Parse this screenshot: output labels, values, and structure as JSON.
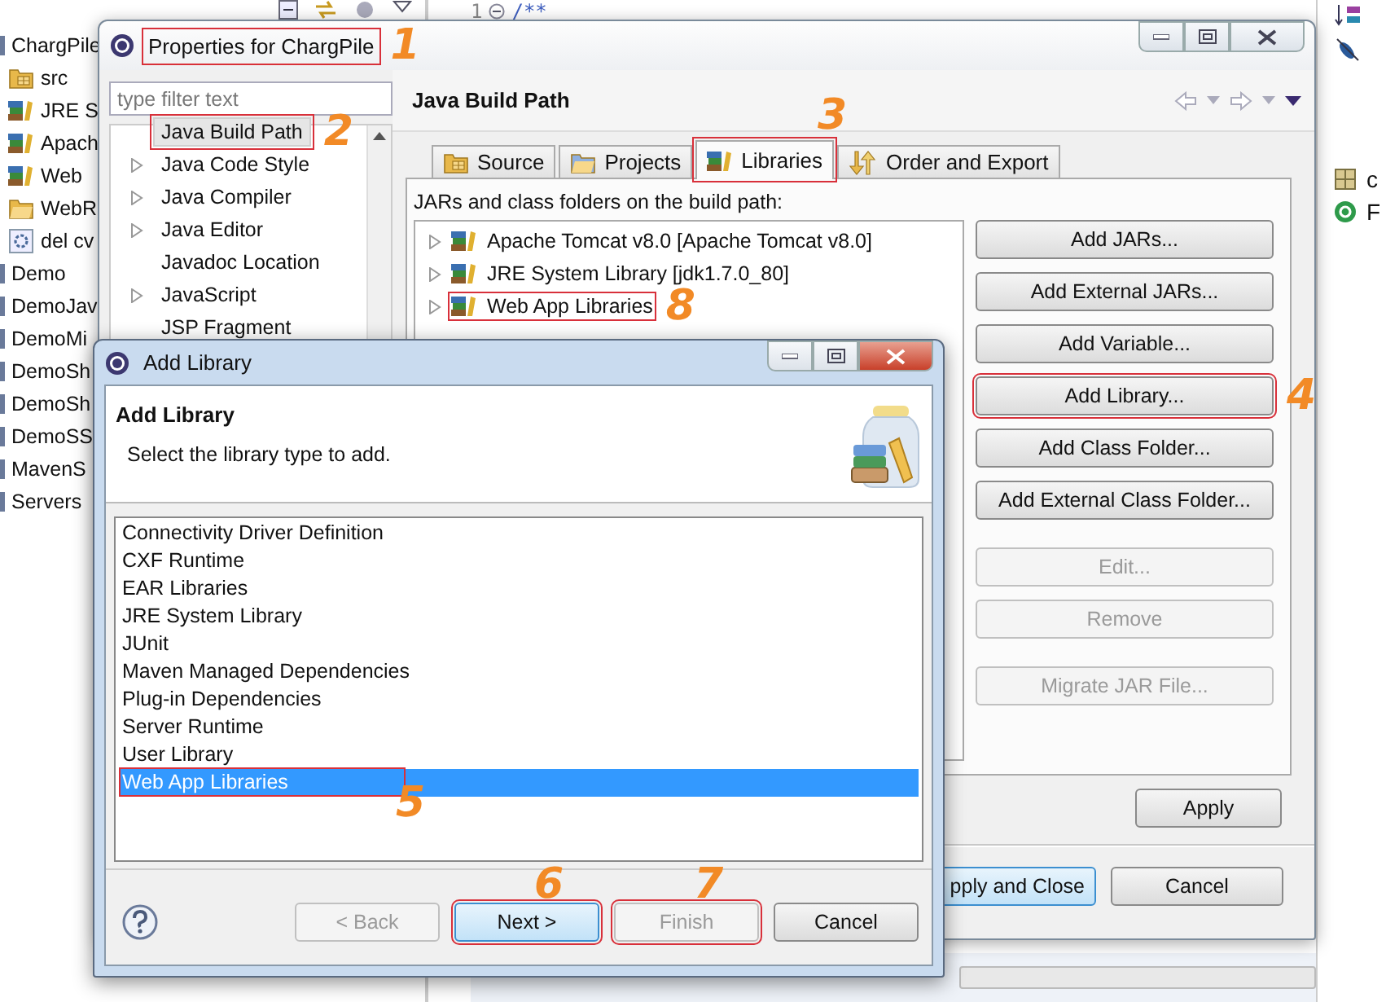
{
  "background_ide": {
    "explorer": {
      "items": [
        {
          "label": "ChargPile",
          "kind": "project",
          "children": [
            {
              "label": "src",
              "kind": "package-folder"
            },
            {
              "label": "JRE S",
              "kind": "library"
            },
            {
              "label": "Apach",
              "kind": "library"
            },
            {
              "label": "Web",
              "kind": "library"
            },
            {
              "label": "WebR",
              "kind": "folder"
            },
            {
              "label": "del cv",
              "kind": "file"
            }
          ]
        },
        {
          "label": "Demo",
          "kind": "project"
        },
        {
          "label": "DemoJav",
          "kind": "project"
        },
        {
          "label": "DemoMi",
          "kind": "project"
        },
        {
          "label": "DemoSh",
          "kind": "project"
        },
        {
          "label": "DemoSh",
          "kind": "project"
        },
        {
          "label": "DemoSS",
          "kind": "project"
        },
        {
          "label": "MavenS",
          "kind": "project"
        },
        {
          "label": "Servers",
          "kind": "project"
        }
      ]
    },
    "editor": {
      "line_number": "1",
      "code": "/**"
    },
    "outline": {
      "items": [
        {
          "label": "c",
          "kind": "grid"
        },
        {
          "label": "F",
          "kind": "class"
        }
      ]
    }
  },
  "properties_dialog": {
    "title": "Properties for ChargPile",
    "title_annotation": "1",
    "filter": {
      "placeholder": "type filter text"
    },
    "tree": [
      {
        "label": "Java Build Path",
        "expandable": false,
        "selected": true,
        "annotation": "2"
      },
      {
        "label": "Java Code Style",
        "expandable": true,
        "selected": false
      },
      {
        "label": "Java Compiler",
        "expandable": true,
        "selected": false
      },
      {
        "label": "Java Editor",
        "expandable": true,
        "selected": false
      },
      {
        "label": "Javadoc Location",
        "expandable": false,
        "selected": false
      },
      {
        "label": "JavaScript",
        "expandable": true,
        "selected": false
      },
      {
        "label": "JSP Fragment",
        "expandable": false,
        "selected": false
      }
    ],
    "page_title": "Java Build Path",
    "tabs": [
      {
        "label": "Source",
        "kind": "source",
        "selected": false
      },
      {
        "label": "Projects",
        "kind": "projects",
        "selected": false
      },
      {
        "label": "Libraries",
        "kind": "libraries",
        "selected": true,
        "annotation": "3"
      },
      {
        "label": "Order and Export",
        "kind": "order",
        "selected": false
      }
    ],
    "list_label": "JARs and class folders on the build path:",
    "libraries": [
      {
        "label": "Apache Tomcat v8.0 [Apache Tomcat v8.0]"
      },
      {
        "label": "JRE System Library [jdk1.7.0_80]"
      },
      {
        "label": "Web App Libraries",
        "annotation": "8"
      }
    ],
    "button_groups": [
      [
        {
          "label": "Add JARs...",
          "disabled": false
        },
        {
          "label": "Add External JARs...",
          "disabled": false
        },
        {
          "label": "Add Variable...",
          "disabled": false
        },
        {
          "label": "Add Library...",
          "disabled": false,
          "annotation": "4"
        },
        {
          "label": "Add Class Folder...",
          "disabled": false
        },
        {
          "label": "Add External Class Folder...",
          "disabled": false
        }
      ],
      [
        {
          "label": "Edit...",
          "disabled": true
        },
        {
          "label": "Remove",
          "disabled": true
        }
      ],
      [
        {
          "label": "Migrate JAR File...",
          "disabled": true
        }
      ]
    ],
    "apply": "Apply",
    "footer_buttons": [
      {
        "label": "pply and Close",
        "default": true
      },
      {
        "label": "Cancel",
        "default": false
      }
    ]
  },
  "add_library_dialog": {
    "title": "Add Library",
    "heading": "Add Library",
    "description": "Select the library type to add.",
    "items": [
      {
        "label": "Connectivity Driver Definition",
        "selected": false
      },
      {
        "label": "CXF Runtime",
        "selected": false
      },
      {
        "label": "EAR Libraries",
        "selected": false
      },
      {
        "label": "JRE System Library",
        "selected": false
      },
      {
        "label": "JUnit",
        "selected": false
      },
      {
        "label": "Maven Managed Dependencies",
        "selected": false
      },
      {
        "label": "Plug-in Dependencies",
        "selected": false
      },
      {
        "label": "Server Runtime",
        "selected": false
      },
      {
        "label": "User Library",
        "selected": false
      },
      {
        "label": "Web App Libraries",
        "selected": true,
        "annotation": "5"
      }
    ],
    "buttons": [
      {
        "label": "< Back",
        "disabled": true,
        "default": false
      },
      {
        "label": "Next >",
        "disabled": false,
        "default": true,
        "annotation": "6"
      },
      {
        "label": "Finish",
        "disabled": true,
        "default": false,
        "annotation": "7"
      },
      {
        "label": "Cancel",
        "disabled": false,
        "default": false
      }
    ]
  }
}
